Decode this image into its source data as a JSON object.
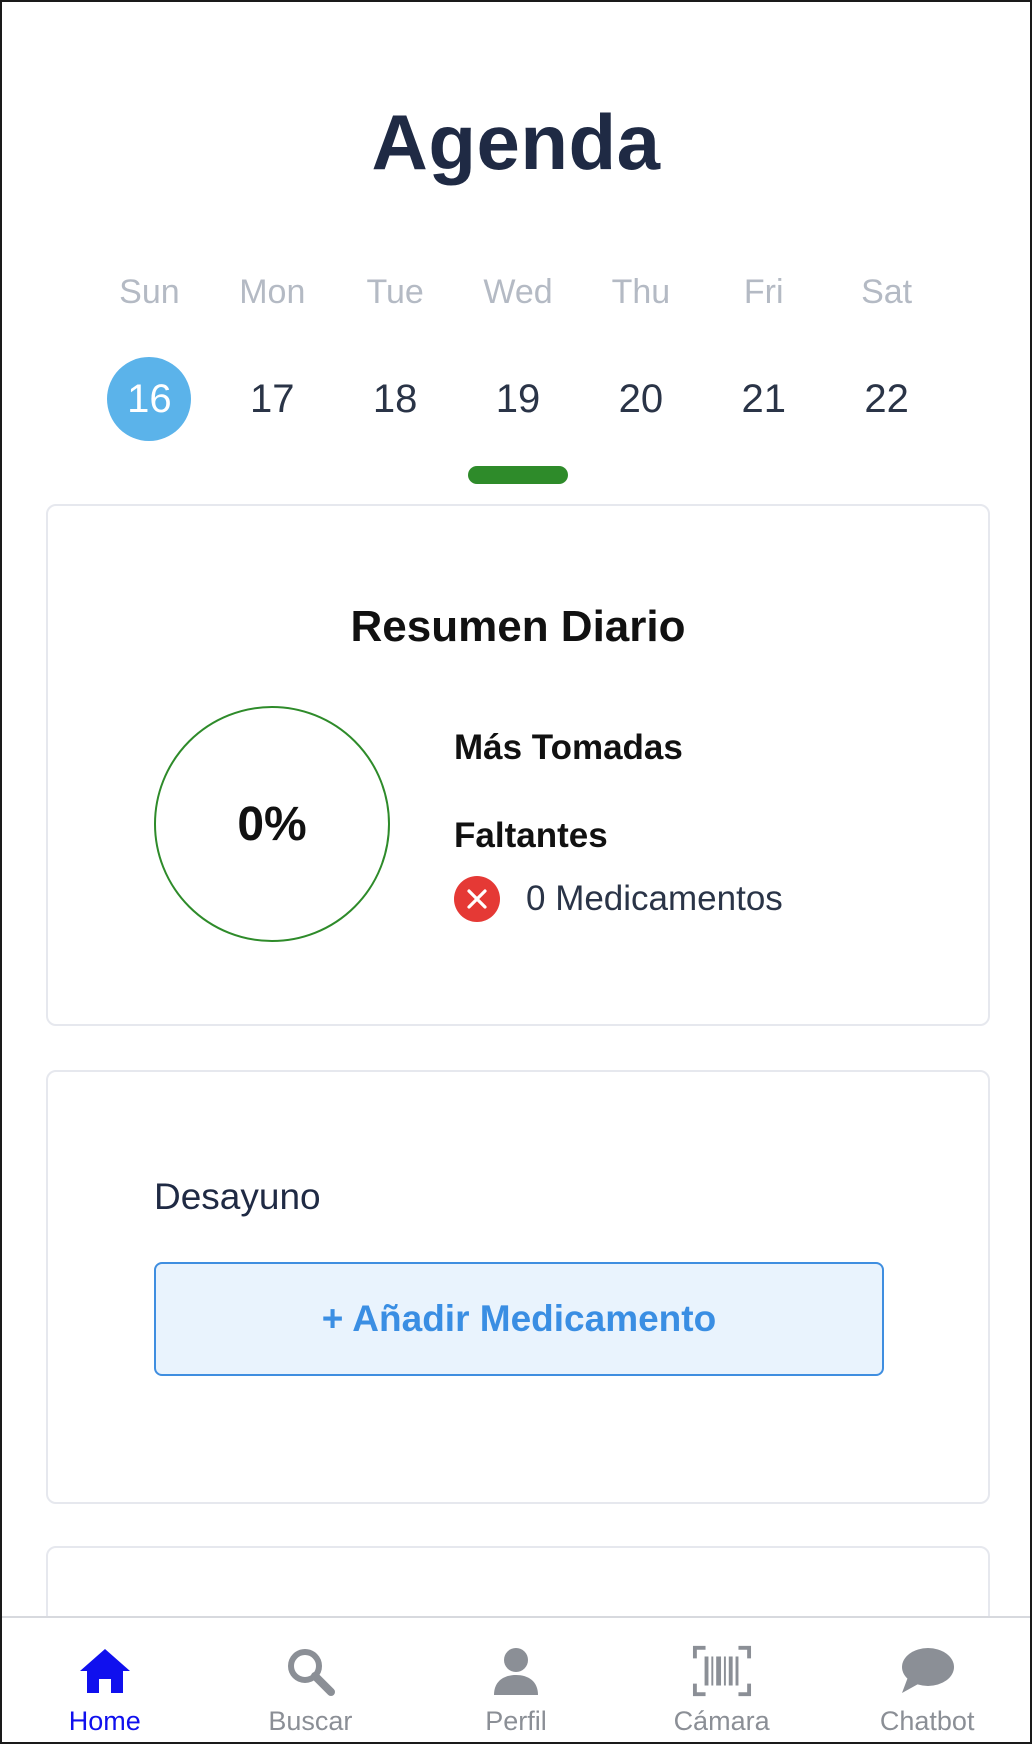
{
  "header": {
    "title": "Agenda"
  },
  "week": {
    "days": [
      {
        "name": "Sun",
        "number": "16"
      },
      {
        "name": "Mon",
        "number": "17"
      },
      {
        "name": "Tue",
        "number": "18"
      },
      {
        "name": "Wed",
        "number": "19"
      },
      {
        "name": "Thu",
        "number": "20"
      },
      {
        "name": "Fri",
        "number": "21"
      },
      {
        "name": "Sat",
        "number": "22"
      }
    ],
    "selected_index": 0
  },
  "summary": {
    "title": "Resumen Diario",
    "progress": "0%",
    "progress_fraction": 0,
    "taken_label": "Más Tomadas",
    "missing_label": "Faltantes",
    "missing_text": "0 Medicamentos"
  },
  "meal": {
    "name": "Desayuno",
    "add_button": "+ Añadir Medicamento"
  },
  "tabbar": {
    "items": [
      {
        "label": "Home",
        "icon": "home-icon"
      },
      {
        "label": "Buscar",
        "icon": "search-icon"
      },
      {
        "label": "Perfil",
        "icon": "person-icon"
      },
      {
        "label": "Cámara",
        "icon": "barcode-scanner-icon"
      },
      {
        "label": "Chatbot",
        "icon": "chat-bubble-icon"
      }
    ],
    "active_index": 0
  },
  "colors": {
    "title": "#1f2a44",
    "selected_day": "#5bb3ea",
    "accent_green": "#2e8b2a",
    "button_blue": "#3a8ee3",
    "tab_active": "#1010ee",
    "tab_inactive": "#8b8f96",
    "error_red": "#e53935"
  }
}
